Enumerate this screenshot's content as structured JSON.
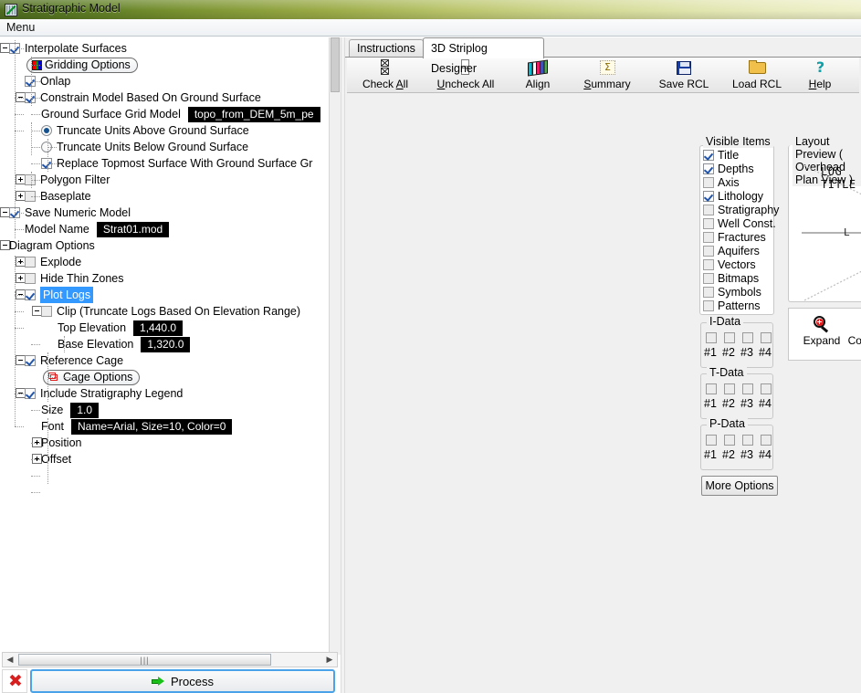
{
  "window": {
    "title": "Stratigraphic Model",
    "icon": "app-icon"
  },
  "menubar": {
    "menu_label": "Menu"
  },
  "tree": {
    "nodes": [
      {
        "id": "interpolate-surfaces",
        "label": "Interpolate Surfaces",
        "indent": 0,
        "toggle": "minus",
        "control": "checkbox-on"
      },
      {
        "id": "gridding-options",
        "label": "Gridding Options",
        "indent": 1,
        "control": "button",
        "icon": "grid-icon"
      },
      {
        "id": "onlap",
        "label": "Onlap",
        "indent": 1,
        "control": "checkbox-on"
      },
      {
        "id": "constrain-model",
        "label": "Constrain Model Based On Ground Surface",
        "indent": 1,
        "toggle": "minus",
        "control": "checkbox-on"
      },
      {
        "id": "ground-surface-grid-model",
        "label": "Ground Surface Grid Model",
        "indent": 2,
        "control": "value",
        "value": "topo_from_DEM_5m_pe"
      },
      {
        "id": "truncate-above",
        "label": "Truncate Units Above Ground Surface",
        "indent": 2,
        "control": "radio-on"
      },
      {
        "id": "truncate-below",
        "label": "Truncate Units Below Ground Surface",
        "indent": 2,
        "control": "radio-off"
      },
      {
        "id": "replace-topmost",
        "label": "Replace Topmost Surface With Ground Surface Gr",
        "indent": 2,
        "control": "checkbox-on"
      },
      {
        "id": "polygon-filter",
        "label": "Polygon Filter",
        "indent": 1,
        "toggle": "plus",
        "control": "checkbox-off"
      },
      {
        "id": "baseplate",
        "label": "Baseplate",
        "indent": 1,
        "toggle": "plus",
        "control": "checkbox-off"
      },
      {
        "id": "save-numeric-model",
        "label": "Save Numeric Model",
        "indent": 0,
        "toggle": "minus",
        "control": "checkbox-on"
      },
      {
        "id": "model-name",
        "label": "Model Name",
        "indent": 1,
        "control": "value",
        "value": "Strat01.mod"
      },
      {
        "id": "diagram-options",
        "label": "Diagram Options",
        "indent": 0,
        "toggle": "minus",
        "control": "none"
      },
      {
        "id": "explode",
        "label": "Explode",
        "indent": 1,
        "toggle": "plus",
        "control": "checkbox-off"
      },
      {
        "id": "hide-thin-zones",
        "label": "Hide Thin Zones",
        "indent": 1,
        "toggle": "plus",
        "control": "checkbox-off"
      },
      {
        "id": "plot-logs",
        "label": "Plot Logs",
        "indent": 1,
        "toggle": "minus",
        "control": "checkbox-on",
        "selected": true
      },
      {
        "id": "clip-truncate-logs",
        "label": "Clip (Truncate Logs Based On Elevation Range)",
        "indent": 2,
        "toggle": "minus",
        "control": "checkbox-off"
      },
      {
        "id": "top-elevation",
        "label": "Top Elevation",
        "indent": 3,
        "control": "value",
        "value": "1,440.0"
      },
      {
        "id": "base-elevation",
        "label": "Base Elevation",
        "indent": 3,
        "control": "value",
        "value": "1,320.0"
      },
      {
        "id": "reference-cage",
        "label": "Reference Cage",
        "indent": 1,
        "toggle": "minus",
        "control": "checkbox-on"
      },
      {
        "id": "cage-options",
        "label": "Cage Options",
        "indent": 2,
        "control": "button",
        "icon": "cage-icon"
      },
      {
        "id": "include-stratigraphy-legend",
        "label": "Include Stratigraphy Legend",
        "indent": 1,
        "toggle": "minus",
        "control": "checkbox-on"
      },
      {
        "id": "legend-size",
        "label": "Size",
        "indent": 2,
        "control": "value",
        "value": "1.0"
      },
      {
        "id": "legend-font",
        "label": "Font",
        "indent": 2,
        "control": "value",
        "value": "Name=Arial, Size=10, Color=0"
      },
      {
        "id": "position",
        "label": "Position",
        "indent": 2,
        "toggle": "plus",
        "control": "none"
      },
      {
        "id": "offset",
        "label": "Offset",
        "indent": 2,
        "toggle": "plus",
        "control": "none"
      }
    ]
  },
  "scrollbars": {
    "horizontal_left_arrow": "◀",
    "horizontal_right_arrow": "▶",
    "thumb_grip": "|||"
  },
  "bottom": {
    "cancel_label": "✖",
    "process_label": "Process"
  },
  "tabs": [
    {
      "id": "instructions",
      "label": "Instructions",
      "active": false
    },
    {
      "id": "3d-striplog-designer",
      "label": "3D Striplog Designer",
      "active": true
    }
  ],
  "toolbar": [
    {
      "id": "check-all",
      "label": "Check All",
      "icon": "check-all-icon",
      "accel": "A"
    },
    {
      "id": "uncheck-all",
      "label": "Uncheck All",
      "icon": "uncheck-all-icon",
      "accel": "U"
    },
    {
      "id": "align",
      "label": "Align",
      "icon": "align-icon",
      "accel": ""
    },
    {
      "id": "summary",
      "label": "Summary",
      "icon": "summary-icon",
      "accel": "S"
    },
    {
      "id": "save-rcl",
      "label": "Save RCL",
      "icon": "save-icon",
      "accel": ""
    },
    {
      "id": "load-rcl",
      "label": "Load RCL",
      "icon": "folder-icon",
      "accel": ""
    },
    {
      "id": "help",
      "label": "Help",
      "icon": "help-icon",
      "accel": "H"
    }
  ],
  "visible_items": {
    "group_title": "Visible Items",
    "items": [
      {
        "id": "title",
        "label": "Title",
        "checked": true
      },
      {
        "id": "depths",
        "label": "Depths",
        "checked": true
      },
      {
        "id": "axis",
        "label": "Axis",
        "checked": false
      },
      {
        "id": "lithology",
        "label": "Lithology",
        "checked": true
      },
      {
        "id": "stratigraphy",
        "label": "Stratigraphy",
        "checked": false
      },
      {
        "id": "well-const",
        "label": "Well Const.",
        "checked": false
      },
      {
        "id": "fractures",
        "label": "Fractures",
        "checked": false
      },
      {
        "id": "aquifers",
        "label": "Aquifers",
        "checked": false
      },
      {
        "id": "vectors",
        "label": "Vectors",
        "checked": false
      },
      {
        "id": "bitmaps",
        "label": "Bitmaps",
        "checked": false
      },
      {
        "id": "symbols",
        "label": "Symbols",
        "checked": false
      },
      {
        "id": "patterns",
        "label": "Patterns",
        "checked": false
      }
    ]
  },
  "data_groups": [
    {
      "id": "i-data",
      "title": "I-Data",
      "labels": [
        "#1",
        "#2",
        "#3",
        "#4"
      ],
      "checked": [
        false,
        false,
        false,
        false
      ]
    },
    {
      "id": "t-data",
      "title": "T-Data",
      "labels": [
        "#1",
        "#2",
        "#3",
        "#4"
      ],
      "checked": [
        false,
        false,
        false,
        false
      ]
    },
    {
      "id": "p-data",
      "title": "P-Data",
      "labels": [
        "#1",
        "#2",
        "#3",
        "#4"
      ],
      "checked": [
        false,
        false,
        false,
        false
      ]
    }
  ],
  "more_options": {
    "label": "More Options"
  },
  "preview": {
    "group_title": "Layout Preview  ( Overhead Plan View )",
    "log_title": "LOG TITLE",
    "node_label": "L",
    "node_color": "#ffff00"
  },
  "zoom_tools": [
    {
      "id": "expand",
      "label": "Expand",
      "icon": "magnifier-plus-icon"
    },
    {
      "id": "collapse",
      "label": "Collapse",
      "icon": "magnifier-minus-icon"
    }
  ]
}
